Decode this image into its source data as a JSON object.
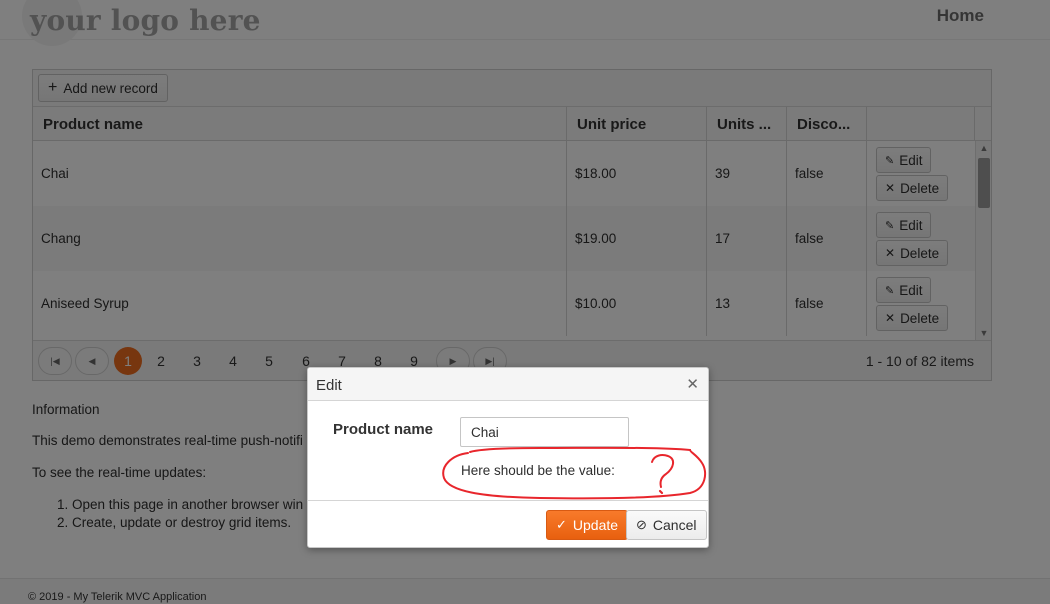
{
  "header": {
    "logo": "your logo here",
    "nav_home": "Home"
  },
  "toolbar": {
    "add_label": "Add new record"
  },
  "grid": {
    "columns": [
      "Product name",
      "Unit price",
      "Units ...",
      "Disco..."
    ],
    "rows": [
      {
        "name": "Chai",
        "price": "$18.00",
        "units": "39",
        "discontinued": "false"
      },
      {
        "name": "Chang",
        "price": "$19.00",
        "units": "17",
        "discontinued": "false"
      },
      {
        "name": "Aniseed Syrup",
        "price": "$10.00",
        "units": "13",
        "discontinued": "false"
      }
    ],
    "edit_label": "Edit",
    "delete_label": "Delete"
  },
  "pager": {
    "pages": [
      "1",
      "2",
      "3",
      "4",
      "5",
      "6",
      "7",
      "8",
      "9"
    ],
    "current": "1",
    "info": "1 - 10 of 82 items"
  },
  "info": {
    "heading": "Information",
    "line1": "This demo demonstrates real-time push-notifi",
    "line2": "To see the real-time updates:",
    "steps": [
      "Open this page in another browser win",
      "Create, update or destroy grid items."
    ]
  },
  "footer": {
    "text": "© 2019 - My Telerik MVC Application"
  },
  "dialog": {
    "title": "Edit",
    "field_label": "Product name",
    "field_value": "Chai",
    "hint": "Here should be the value:",
    "update_label": "Update",
    "cancel_label": "Cancel",
    "annotation_color": "#e8262c"
  },
  "colors": {
    "accent": "#ef6c1e",
    "overlay": "rgba(0,0,0,0.5)"
  }
}
